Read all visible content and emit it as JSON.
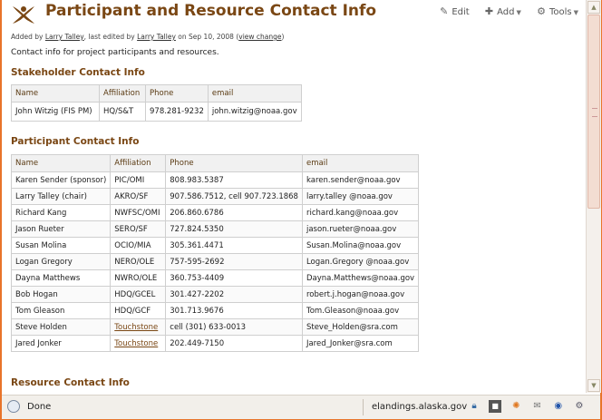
{
  "page": {
    "title": "Participant and Resource Contact Info",
    "actions": [
      {
        "label": "Edit",
        "icon": "pencil-icon"
      },
      {
        "label": "Add",
        "icon": "plus-icon"
      },
      {
        "label": "Tools",
        "icon": "gear-icon"
      }
    ],
    "meta": {
      "added_by_prefix": "Added by",
      "added_by": "Larry Talley",
      "edited_by_prefix": ", last edited by",
      "edited_by": "Larry Talley",
      "date_prefix": "on Sep 10, 2008",
      "view_change": "view change"
    },
    "description": "Contact info for project participants and resources."
  },
  "stakeholder": {
    "heading": "Stakeholder Contact Info",
    "columns": [
      "Name",
      "Affiliation",
      "Phone",
      "email"
    ],
    "rows": [
      [
        "John Witzig (FIS PM)",
        "HQ/S&T",
        "978.281-9232",
        "john.witzig@noaa.gov"
      ]
    ]
  },
  "participant": {
    "heading": "Participant Contact Info",
    "columns": [
      "Name",
      "Affiliation",
      "Phone",
      "email"
    ],
    "rows": [
      [
        "Karen Sender (sponsor)",
        "PIC/OMI",
        "808.983.5387",
        "karen.sender@noaa.gov"
      ],
      [
        "Larry Talley (chair)",
        "AKRO/SF",
        "907.586.7512, cell 907.723.1868",
        "larry.talley @noaa.gov"
      ],
      [
        "Richard Kang",
        "NWFSC/OMI",
        "206.860.6786",
        "richard.kang@noaa.gov"
      ],
      [
        "Jason Rueter",
        "SERO/SF",
        "727.824.5350",
        "jason.rueter@noaa.gov"
      ],
      [
        "Susan Molina",
        "OCIO/MIA",
        "305.361.4471",
        "Susan.Molina@noaa.gov"
      ],
      [
        "Logan Gregory",
        "NERO/OLE",
        "757-595-2692",
        "Logan.Gregory @noaa.gov"
      ],
      [
        "Dayna Matthews",
        "NWRO/OLE",
        "360.753-4409",
        "Dayna.Matthews@noaa.gov"
      ],
      [
        "Bob Hogan",
        "HDQ/GCEL",
        "301.427-2202",
        "robert.j.hogan@noaa.gov"
      ],
      [
        "Tom Gleason",
        "HDQ/GCF",
        "301.713.9676",
        "Tom.Gleason@noaa.gov"
      ],
      [
        "Steve Holden",
        "Touchstone",
        "cell (301) 633-0013",
        "Steve_Holden@sra.com"
      ],
      [
        "Jared Jonker",
        "Touchstone",
        "202.449-7150",
        "Jared_Jonker@sra.com"
      ]
    ],
    "linked_affiliation": "Touchstone"
  },
  "resource": {
    "heading": "Resource Contact Info"
  },
  "statusbar": {
    "status": "Done",
    "host": "elandings.alaska.gov",
    "tray_icons": [
      "lock-icon",
      "block-icon",
      "puzzle-icon",
      "mail-icon",
      "globe-icon",
      "gear-icon"
    ]
  },
  "colors": {
    "heading": "#7a4714",
    "frame": "#e8742a"
  }
}
